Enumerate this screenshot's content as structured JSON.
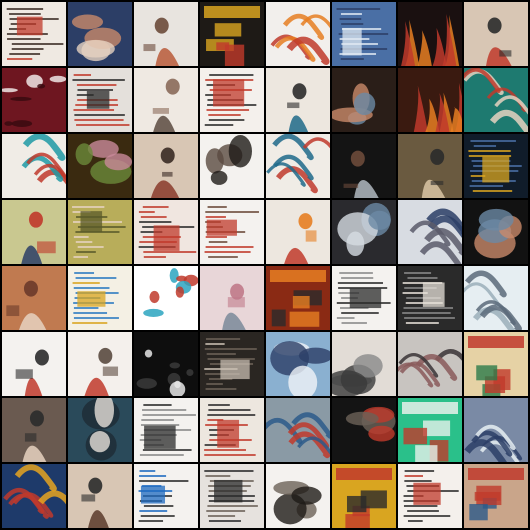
{
  "grid": {
    "rows": 8,
    "cols": 8,
    "tiles": [
      {
        "bg": "#efe9e2",
        "fg": "#c0392b",
        "accent": "#3a2a24",
        "motif": "page"
      },
      {
        "bg": "#2c3e66",
        "fg": "#c98a6a",
        "accent": "#e6d2c0",
        "motif": "blob"
      },
      {
        "bg": "#e8e4df",
        "fg": "#b85a3a",
        "accent": "#6b4a3a",
        "motif": "figure"
      },
      {
        "bg": "#1e1a16",
        "fg": "#d9a520",
        "accent": "#c0392b",
        "motif": "poster"
      },
      {
        "bg": "#f2efec",
        "fg": "#c0392b",
        "accent": "#e67e22",
        "motif": "swirl"
      },
      {
        "bg": "#4a6fa5",
        "fg": "#dfe8f2",
        "accent": "#2c3e66",
        "motif": "page"
      },
      {
        "bg": "#1a1010",
        "fg": "#e67e22",
        "accent": "#c0392b",
        "motif": "fire"
      },
      {
        "bg": "#d8c6b4",
        "fg": "#c0392b",
        "accent": "#2b2b2b",
        "motif": "figure"
      },
      {
        "bg": "#6e1620",
        "fg": "#f0e6e6",
        "accent": "#3a0a10",
        "motif": "spots"
      },
      {
        "bg": "#e4e0db",
        "fg": "#2b2b2b",
        "accent": "#c0392b",
        "motif": "text"
      },
      {
        "bg": "#efe9e2",
        "fg": "#5a4a40",
        "accent": "#8a6a5a",
        "motif": "figure"
      },
      {
        "bg": "#f4f0ec",
        "fg": "#c0392b",
        "accent": "#2b2b2b",
        "motif": "text"
      },
      {
        "bg": "#ede7df",
        "fg": "#1e6a8a",
        "accent": "#2b2b2b",
        "motif": "figure"
      },
      {
        "bg": "#2a1e18",
        "fg": "#6b8aa5",
        "accent": "#c98a6a",
        "motif": "blob"
      },
      {
        "bg": "#3a1a10",
        "fg": "#e67e22",
        "accent": "#c0392b",
        "motif": "fire"
      },
      {
        "bg": "#1e7a70",
        "fg": "#c0392b",
        "accent": "#e6d2c0",
        "motif": "swirl"
      },
      {
        "bg": "#f0ece6",
        "fg": "#1e9aa5",
        "accent": "#c0392b",
        "motif": "swirl"
      },
      {
        "bg": "#3a2a10",
        "fg": "#c98a9a",
        "accent": "#6b8a3a",
        "motif": "blob"
      },
      {
        "bg": "#d8c6b4",
        "fg": "#8a3a2a",
        "accent": "#3a2a24",
        "motif": "figure"
      },
      {
        "bg": "#f4f2ef",
        "fg": "#1e1a16",
        "accent": "#5a4a40",
        "motif": "blob"
      },
      {
        "bg": "#f0ece6",
        "fg": "#c0392b",
        "accent": "#1e6a8a",
        "motif": "swirl"
      },
      {
        "bg": "#141414",
        "fg": "#b0b8c0",
        "accent": "#6b4a3a",
        "motif": "figure"
      },
      {
        "bg": "#6a5a40",
        "fg": "#d9c6a5",
        "accent": "#2b2b2b",
        "motif": "figure"
      },
      {
        "bg": "#101c2a",
        "fg": "#d9a520",
        "accent": "#4a6fa5",
        "motif": "page"
      },
      {
        "bg": "#c9c890",
        "fg": "#2c3e66",
        "accent": "#c0392b",
        "motif": "figure"
      },
      {
        "bg": "#b8ad5a",
        "fg": "#5a5a2a",
        "accent": "#e6d2c0",
        "motif": "text"
      },
      {
        "bg": "#f0e6e0",
        "fg": "#c0392b",
        "accent": "#2b2b2b",
        "motif": "text"
      },
      {
        "bg": "#f4f2ef",
        "fg": "#c0392b",
        "accent": "#6b4a3a",
        "motif": "text"
      },
      {
        "bg": "#ede7df",
        "fg": "#c0392b",
        "accent": "#e67e22",
        "motif": "figure"
      },
      {
        "bg": "#2a2a2e",
        "fg": "#d6dce2",
        "accent": "#6b8aa5",
        "motif": "blob"
      },
      {
        "bg": "#d8dce2",
        "fg": "#2c3e66",
        "accent": "#5a5a6a",
        "motif": "swirl"
      },
      {
        "bg": "#121212",
        "fg": "#6b8aa5",
        "accent": "#c98a6a",
        "motif": "blob"
      },
      {
        "bg": "#c07a50",
        "fg": "#e6d2c0",
        "accent": "#6b3a2a",
        "motif": "figure"
      },
      {
        "bg": "#f4f0e4",
        "fg": "#d9a520",
        "accent": "#2c7ac0",
        "motif": "text"
      },
      {
        "bg": "#ffffff",
        "fg": "#2ca5c0",
        "accent": "#c0392b",
        "motif": "spots"
      },
      {
        "bg": "#e8d6d8",
        "fg": "#7a8a9a",
        "accent": "#c07a8a",
        "motif": "figure"
      },
      {
        "bg": "#8a2a14",
        "fg": "#e67e22",
        "accent": "#2b2b2b",
        "motif": "poster"
      },
      {
        "bg": "#f4f2ef",
        "fg": "#2b2b2b",
        "accent": "#8a8a8a",
        "motif": "text"
      },
      {
        "bg": "#2a2a2a",
        "fg": "#e6e0d8",
        "accent": "#8a8a8a",
        "motif": "page"
      },
      {
        "bg": "#e6eef2",
        "fg": "#9aaeba",
        "accent": "#5a6a7a",
        "motif": "swirl"
      },
      {
        "bg": "#f4f2ef",
        "fg": "#c0392b",
        "accent": "#2b2b2b",
        "motif": "figure"
      },
      {
        "bg": "#f4f0ec",
        "fg": "#c0392b",
        "accent": "#5a4a40",
        "motif": "figure"
      },
      {
        "bg": "#0e0e0e",
        "fg": "#e6e6e6",
        "accent": "#3a3a3a",
        "motif": "spots"
      },
      {
        "bg": "#2a2622",
        "fg": "#c8beb2",
        "accent": "#6b6258",
        "motif": "page"
      },
      {
        "bg": "#8ab0d0",
        "fg": "#2c3e66",
        "accent": "#f0f4f8",
        "motif": "blob"
      },
      {
        "bg": "#e2dcd6",
        "fg": "#3a3a3a",
        "accent": "#8a8a8a",
        "motif": "blob"
      },
      {
        "bg": "#c8c4c0",
        "fg": "#3a3436",
        "accent": "#8a5a5a",
        "motif": "swirl"
      },
      {
        "bg": "#e6d2a5",
        "fg": "#c0392b",
        "accent": "#2c7a4a",
        "motif": "poster"
      },
      {
        "bg": "#6a5a50",
        "fg": "#e6d2c0",
        "accent": "#2b2b2b",
        "motif": "figure"
      },
      {
        "bg": "#2a4a5a",
        "fg": "#e6e0d8",
        "accent": "#1e2a34",
        "motif": "blob"
      },
      {
        "bg": "#f4f2ef",
        "fg": "#2b2b2b",
        "accent": "#8a8a8a",
        "motif": "text"
      },
      {
        "bg": "#ede7df",
        "fg": "#c0392b",
        "accent": "#2b2b2b",
        "motif": "text"
      },
      {
        "bg": "#8a9aa5",
        "fg": "#c0392b",
        "accent": "#2c5a8a",
        "motif": "swirl"
      },
      {
        "bg": "#141414",
        "fg": "#c0392b",
        "accent": "#6b6258",
        "motif": "blob"
      },
      {
        "bg": "#2ac08a",
        "fg": "#e6f0ea",
        "accent": "#c0392b",
        "motif": "poster"
      },
      {
        "bg": "#7a8aa5",
        "fg": "#e6eef2",
        "accent": "#2c3e66",
        "motif": "swirl"
      },
      {
        "bg": "#1e3a6a",
        "fg": "#e6a520",
        "accent": "#c0392b",
        "motif": "swirl"
      },
      {
        "bg": "#d8c6b4",
        "fg": "#5a3a2a",
        "accent": "#2b2b2b",
        "motif": "figure"
      },
      {
        "bg": "#f4f2ef",
        "fg": "#1e6ac0",
        "accent": "#2b2b2b",
        "motif": "text"
      },
      {
        "bg": "#e6e2de",
        "fg": "#2b2b2b",
        "accent": "#6b6258",
        "motif": "page"
      },
      {
        "bg": "#f4f2ef",
        "fg": "#1e1a16",
        "accent": "#6b6258",
        "motif": "blob"
      },
      {
        "bg": "#d9a520",
        "fg": "#c0392b",
        "accent": "#2b2b2b",
        "motif": "poster"
      },
      {
        "bg": "#f4f0ec",
        "fg": "#c0392b",
        "accent": "#2b2b2b",
        "motif": "page"
      },
      {
        "bg": "#c9a58a",
        "fg": "#c0392b",
        "accent": "#2c5a8a",
        "motif": "poster"
      }
    ]
  }
}
